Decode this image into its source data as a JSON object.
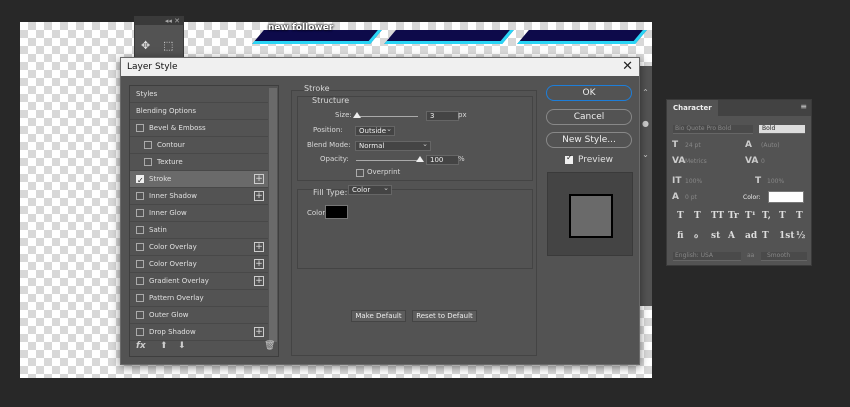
{
  "canvas": {
    "text": "new follower"
  },
  "tools_panel": {
    "collapse": "◂◂",
    "close": "✕"
  },
  "dialog": {
    "title": "Layer Style",
    "close": "✕",
    "styles_header": "Styles",
    "styles": [
      {
        "label": "Blending Options",
        "checkbox": false,
        "plus": false,
        "indent": false,
        "checked": false
      },
      {
        "label": "Bevel & Emboss",
        "checkbox": true,
        "plus": false,
        "indent": false,
        "checked": false
      },
      {
        "label": "Contour",
        "checkbox": true,
        "plus": false,
        "indent": true,
        "checked": false
      },
      {
        "label": "Texture",
        "checkbox": true,
        "plus": false,
        "indent": true,
        "checked": false
      },
      {
        "label": "Stroke",
        "checkbox": true,
        "plus": true,
        "indent": false,
        "checked": true
      },
      {
        "label": "Inner Shadow",
        "checkbox": true,
        "plus": true,
        "indent": false,
        "checked": false
      },
      {
        "label": "Inner Glow",
        "checkbox": true,
        "plus": false,
        "indent": false,
        "checked": false
      },
      {
        "label": "Satin",
        "checkbox": true,
        "plus": false,
        "indent": false,
        "checked": false
      },
      {
        "label": "Color Overlay",
        "checkbox": true,
        "plus": true,
        "indent": false,
        "checked": false
      },
      {
        "label": "Color Overlay",
        "checkbox": true,
        "plus": true,
        "indent": false,
        "checked": false
      },
      {
        "label": "Gradient Overlay",
        "checkbox": true,
        "plus": true,
        "indent": false,
        "checked": false
      },
      {
        "label": "Pattern Overlay",
        "checkbox": true,
        "plus": false,
        "indent": false,
        "checked": false
      },
      {
        "label": "Outer Glow",
        "checkbox": true,
        "plus": false,
        "indent": false,
        "checked": false
      },
      {
        "label": "Drop Shadow",
        "checkbox": true,
        "plus": true,
        "indent": false,
        "checked": false
      }
    ],
    "fx_label": "fx",
    "stroke": {
      "title": "Stroke",
      "structure_title": "Structure",
      "size_label": "Size:",
      "size_value": "3",
      "size_unit": "px",
      "size_fraction": 0.02,
      "position_label": "Position:",
      "position_value": "Outside",
      "blend_label": "Blend Mode:",
      "blend_value": "Normal",
      "opacity_label": "Opacity:",
      "opacity_value": "100",
      "opacity_unit": "%",
      "opacity_fraction": 1.0,
      "overprint_label": "Overprint",
      "fill_type_label": "Fill Type:",
      "fill_type_value": "Color",
      "color_label": "Color:",
      "color_hex": "#000000",
      "make_default": "Make Default",
      "reset_default": "Reset to Default"
    },
    "buttons": {
      "ok": "OK",
      "cancel": "Cancel",
      "new_style": "New Style..."
    },
    "preview_label": "Preview"
  },
  "character": {
    "tab": "Character",
    "menu": "≡",
    "font_family": "Bio Quote Pro Bold",
    "font_style": "Bold",
    "size": "24 pt",
    "leading": "(Auto)",
    "kerning": "Metrics",
    "tracking": "0",
    "vscale": "100%",
    "hscale": "100%",
    "baseline": "0 pt",
    "color_label": "Color:",
    "color_hex": "#ffffff",
    "language": "English: USA",
    "aa_icon": "aa",
    "aa": "Smooth",
    "glyphs_row1": [
      "T",
      "T",
      "TT",
      "Tr",
      "T¹",
      "T,",
      "T",
      "T"
    ],
    "glyphs_row2": [
      "fi",
      "ℴ",
      "st",
      "A",
      "ad",
      "T",
      "1st",
      "½"
    ]
  }
}
